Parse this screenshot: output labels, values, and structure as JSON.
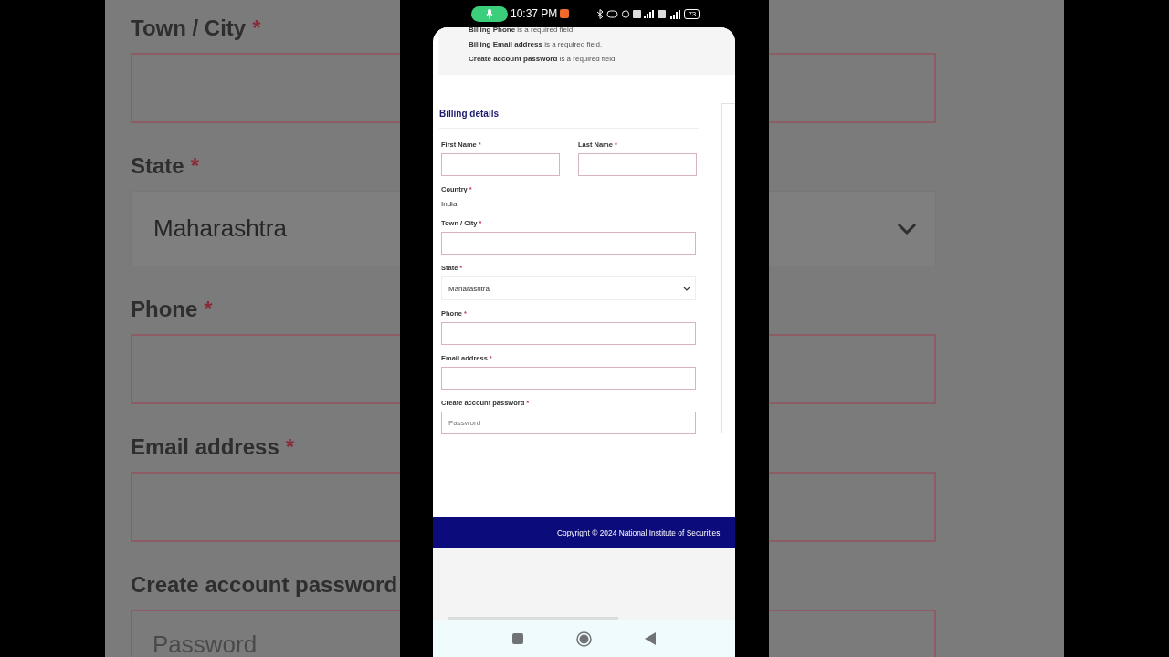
{
  "backdrop": {
    "fields": [
      {
        "kind": "input",
        "label": "Town / City",
        "marker": "*"
      },
      {
        "kind": "select",
        "label": "State",
        "marker": "*",
        "value": "Maharashtra"
      },
      {
        "kind": "input",
        "label": "Phone",
        "marker": "*"
      },
      {
        "kind": "input",
        "label": "Email address",
        "marker": "*"
      },
      {
        "kind": "input",
        "label": "Create account password",
        "placeholder": "Password"
      }
    ]
  },
  "status_bar": {
    "time": "10:37 PM",
    "battery": "73"
  },
  "notices": [
    {
      "text": "**Billing Phone** is a required field."
    },
    {
      "text": "**Billing Email address** is a required field."
    },
    {
      "text": "**Create account password** is a required field."
    }
  ],
  "billing": {
    "title": "Billing details",
    "rows": [
      [
        {
          "kind": "input",
          "label": "First Name",
          "marker": "*"
        },
        {
          "kind": "input",
          "label": "Last Name",
          "marker": "*"
        }
      ],
      [
        {
          "kind": "static",
          "label": "Country",
          "marker": "*",
          "value": "India"
        }
      ],
      [
        {
          "kind": "input",
          "label": "Town / City",
          "marker": "*"
        }
      ],
      [
        {
          "kind": "select",
          "label": "State",
          "marker": "*",
          "value": "Maharashtra"
        }
      ],
      [
        {
          "kind": "input",
          "label": "Phone",
          "marker": "*"
        }
      ],
      [
        {
          "kind": "input",
          "label": "Email address",
          "marker": "*"
        }
      ],
      [
        {
          "kind": "input",
          "label": "Create account password",
          "marker": "*",
          "placeholder": "Password"
        }
      ]
    ]
  },
  "footer": {
    "copyright": "Copyright © 2024 National Institute of Securities"
  }
}
